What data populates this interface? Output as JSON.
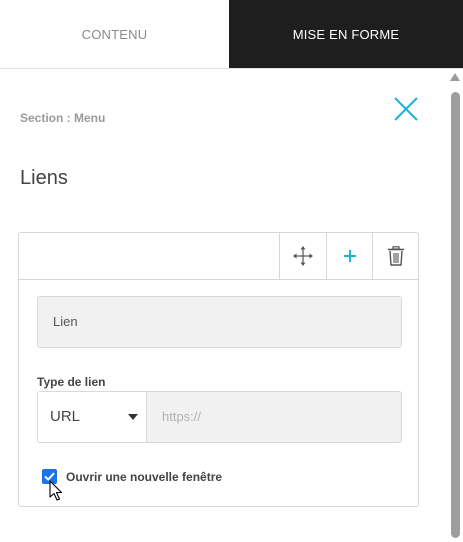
{
  "tabs": [
    {
      "label": "CONTENU",
      "active": false
    },
    {
      "label": "MISE EN FORME",
      "active": true
    }
  ],
  "panel": {
    "section_label": "Section : Menu",
    "title": "Liens"
  },
  "link_item": {
    "name_placeholder": "Lien",
    "type_label": "Type de lien",
    "type_selected": "URL",
    "url_placeholder": "https://",
    "new_window_label": "Ouvrir une nouvelle fenêtre",
    "new_window_checked": true
  },
  "icons": [
    "close-icon",
    "move-icon",
    "plus-icon",
    "trash-icon",
    "checkmark-icon",
    "mouse-pointer-icon"
  ],
  "colors": {
    "accent": "#1fb3d1",
    "active_tab_bg": "#1e1e1e",
    "checkbox_blue": "#1a73e8"
  }
}
